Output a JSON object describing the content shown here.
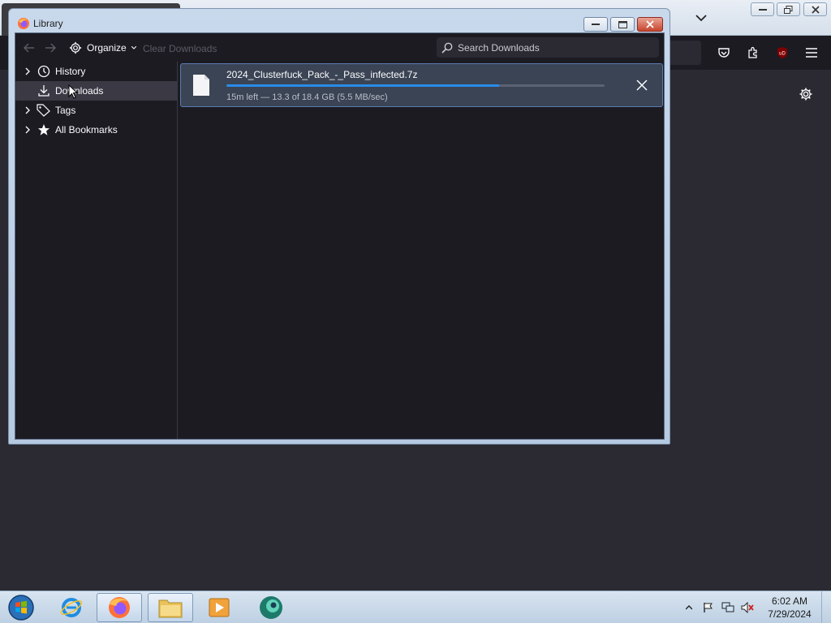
{
  "library": {
    "title": "Library",
    "toolbar": {
      "organize_label": "Organize",
      "clear_downloads_label": "Clear Downloads",
      "search_placeholder": "Search Downloads"
    },
    "sidebar": {
      "items": [
        {
          "label": "History",
          "icon": "clock-icon",
          "expandable": true
        },
        {
          "label": "Downloads",
          "icon": "download-icon",
          "expandable": false,
          "selected": true
        },
        {
          "label": "Tags",
          "icon": "tag-icon",
          "expandable": true
        },
        {
          "label": "All Bookmarks",
          "icon": "star-icon",
          "expandable": true
        }
      ]
    },
    "downloads": [
      {
        "filename": "2024_Clusterfuck_Pack_-_Pass_infected.7z",
        "status": "15m left — 13.3 of 18.4 GB (5.5 MB/sec)",
        "progress_fraction": 0.72
      }
    ]
  },
  "taskbar": {
    "apps": [
      "internet-explorer",
      "firefox",
      "file-explorer",
      "media-player",
      "browser-app"
    ],
    "clock": {
      "time": "6:02 AM",
      "date": "7/29/2024"
    }
  },
  "colors": {
    "accent": "#2a8be8",
    "dark_bg": "#1c1b22",
    "selected_row": "#3a3944"
  }
}
